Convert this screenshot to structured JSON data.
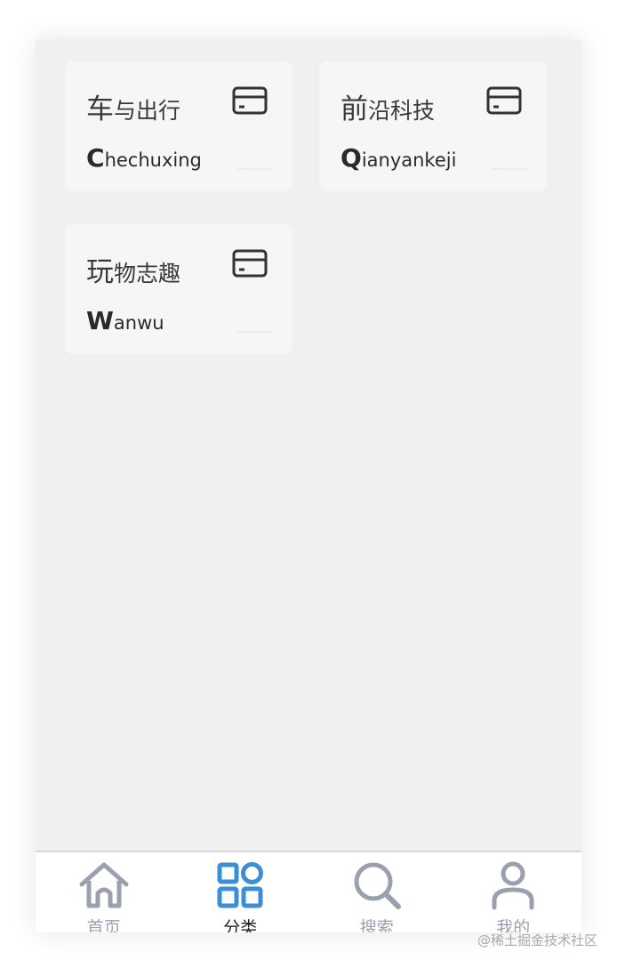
{
  "cards": [
    {
      "title_first": "车",
      "title_rest": "与出行",
      "pinyin_initial": "C",
      "pinyin_rest": "hechuxing",
      "icon": "card-icon"
    },
    {
      "title_first": "前",
      "title_rest": "沿科技",
      "pinyin_initial": "Q",
      "pinyin_rest": "ianyankeji",
      "icon": "card-icon"
    },
    {
      "title_first": "玩",
      "title_rest": "物志趣",
      "pinyin_initial": "W",
      "pinyin_rest": "anwu",
      "icon": "card-icon"
    }
  ],
  "tabbar": {
    "items": [
      {
        "label": "首页",
        "icon": "home-icon",
        "active": false
      },
      {
        "label": "分类",
        "icon": "category-grid-icon",
        "active": true
      },
      {
        "label": "搜索",
        "icon": "search-icon",
        "active": false
      },
      {
        "label": "我的",
        "icon": "profile-icon",
        "active": false
      }
    ]
  },
  "colors": {
    "active": "#3a8fd6",
    "inactive": "#9aa0ad",
    "background": "#f0f0f0",
    "card": "#f6f6f6"
  },
  "watermark": "@稀土掘金技术社区"
}
